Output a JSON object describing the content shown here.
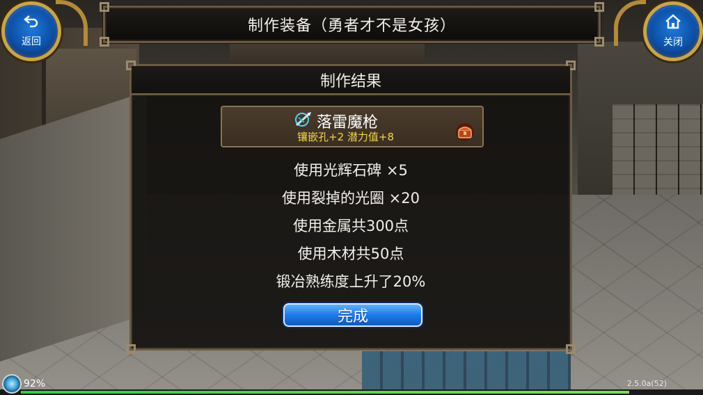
{
  "header": {
    "title": "制作装备（勇者才不是女孩）"
  },
  "buttons": {
    "back": {
      "label": "返回",
      "icon": "back-arrow-icon"
    },
    "close": {
      "label": "关闭",
      "icon": "home-icon"
    }
  },
  "panel": {
    "title": "制作结果",
    "item": {
      "name": "落雷魔枪",
      "attributes": "镶嵌孔+2 潜力值+8",
      "icon": "spear-icon",
      "chest_icon": "treasure-chest-icon"
    },
    "lines": [
      "使用光辉石碑 ×5",
      "使用裂掉的光圈 ×20",
      "使用金属共300点",
      "使用木材共50点",
      "锻冶熟练度上升了20%"
    ],
    "done_label": "完成"
  },
  "status": {
    "percent_text": "92%",
    "progress": 0.92,
    "version": "2.5.0a(52)"
  },
  "colors": {
    "accent_blue": "#1f7ae8",
    "attr_yellow": "#f2d548",
    "frame_bronze": "#6b5a42"
  }
}
